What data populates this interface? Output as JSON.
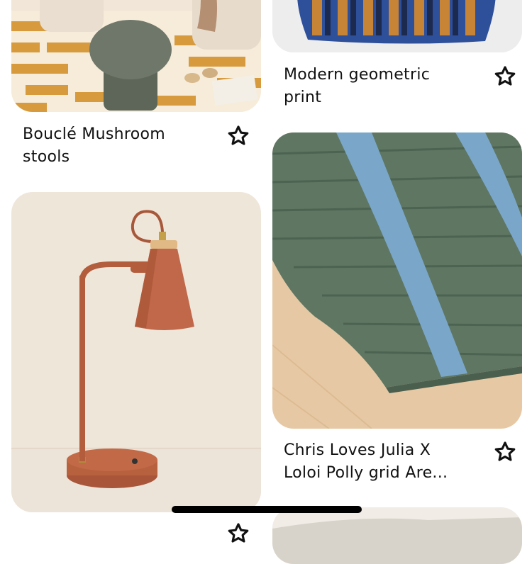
{
  "pins": [
    {
      "title": "Bouclé Mushroom stools",
      "title_line1": "Bouclé Mushroom",
      "title_line2": "stools",
      "icon": "star-icon"
    },
    {
      "title": "Modern geometric print",
      "title_line1": "Modern geometric",
      "title_line2": "print",
      "icon": "star-icon"
    },
    {
      "title": "Chris Loves Julia X Loloi Polly grid Are...",
      "title_line1": "Chris Loves Julia X",
      "title_line2": "Loloi Polly grid Are...",
      "icon": "star-icon"
    },
    {
      "title": "",
      "icon": "star-icon"
    }
  ],
  "colors": {
    "accent_mustard": "#d79a3c",
    "lamp_terracotta": "#b8613f",
    "rug_green": "#5a735f",
    "rug_blue": "#7aa7c9"
  }
}
